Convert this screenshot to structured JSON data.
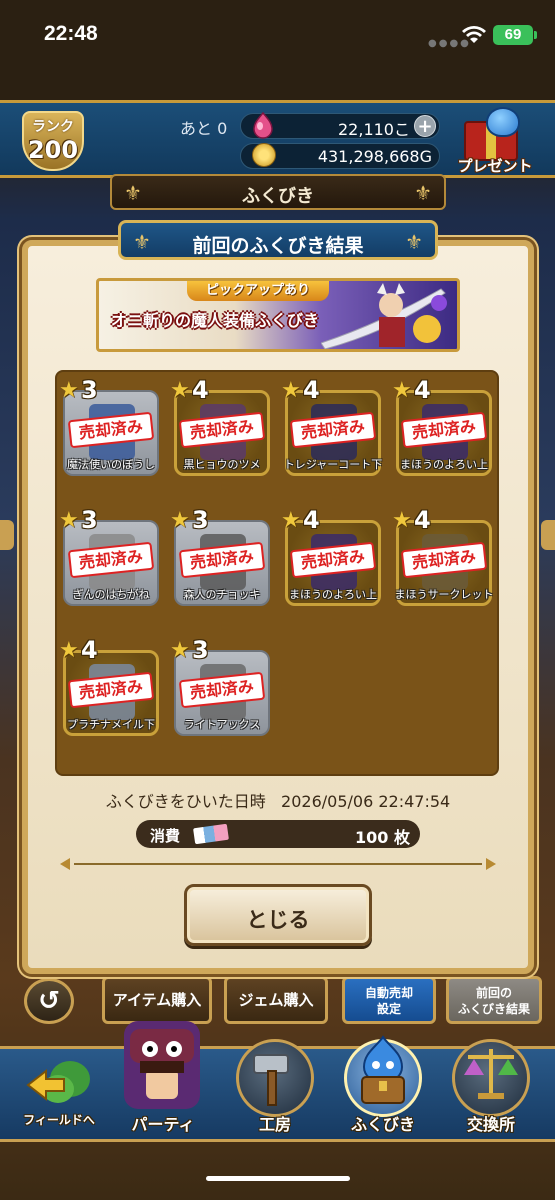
{
  "status_bar": {
    "time": "22:48",
    "battery": "69"
  },
  "header": {
    "rank_label": "ランク",
    "rank_value": "200",
    "remaining_label": "あと 0",
    "gems": "22,110こ",
    "plus": "+",
    "gold": "431,298,668G",
    "present_label": "プレゼント"
  },
  "screen_title": "ふくびき",
  "dialog": {
    "title": "前回のふくびき結果",
    "banner": {
      "pickup_label": "ピックアップあり",
      "title": "オニ斬りの魔人装備ふくびき"
    },
    "items": [
      {
        "stars": "3",
        "name": "魔法使いのぼうし",
        "status": "売却済み"
      },
      {
        "stars": "4",
        "name": "黒ヒョウのツメ",
        "status": "売却済み"
      },
      {
        "stars": "4",
        "name": "トレジャーコート下",
        "status": "売却済み"
      },
      {
        "stars": "4",
        "name": "まほうのよろい上",
        "status": "売却済み"
      },
      {
        "stars": "3",
        "name": "ぎんのはちがね",
        "status": "売却済み"
      },
      {
        "stars": "3",
        "name": "森人のチョッキ",
        "status": "売却済み"
      },
      {
        "stars": "4",
        "name": "まほうのよろい上",
        "status": "売却済み"
      },
      {
        "stars": "4",
        "name": "まほうサークレット",
        "status": "売却済み"
      },
      {
        "stars": "4",
        "name": "プラチナメイル下",
        "status": "売却済み"
      },
      {
        "stars": "3",
        "name": "ライトアックス",
        "status": "売却済み"
      }
    ],
    "draw_date_label": "ふくびきをひいた日時",
    "draw_date_value": "2026/05/06 22:47:54",
    "cost_label": "消費",
    "cost_value": "100 枚",
    "close_label": "とじる"
  },
  "sub_buttons": {
    "back": "↺",
    "item_buy": "アイテム購入",
    "gem_buy": "ジェム購入",
    "auto_sell_line1": "自動売却",
    "auto_sell_line2": "設定",
    "prev_result_line1": "前回の",
    "prev_result_line2": "ふくびき結果"
  },
  "bottom_nav": {
    "field": "フィールドへ",
    "party": "パーティ",
    "workshop": "工房",
    "fukubiki": "ふくびき",
    "exchange": "交換所"
  },
  "colors": {
    "sold_red": "#dd2222",
    "tile_gold": "#c9a13a",
    "tile_silver": "#8e949c",
    "header_blue": "#1b4e78",
    "frame_gold": "#cfa85a"
  },
  "icons": [
    "wifi-icon",
    "gem-icon",
    "gold-coin-icon",
    "present-icon",
    "star-icon",
    "ticket-icon",
    "slime-icon",
    "hammer-icon",
    "arrow-icon"
  ]
}
